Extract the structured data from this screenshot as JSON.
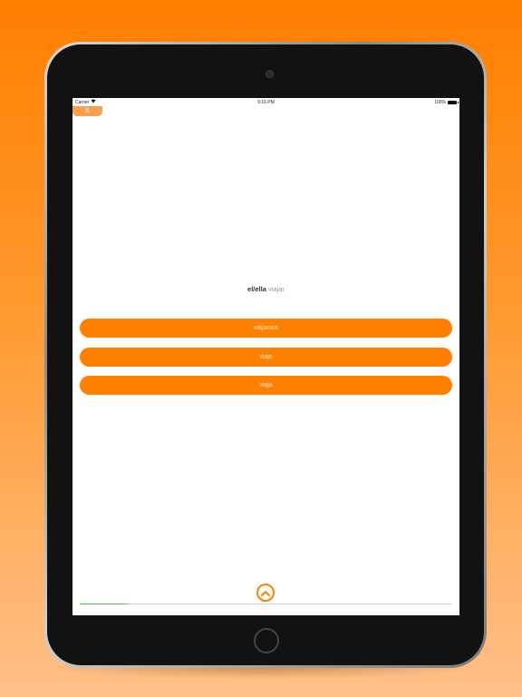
{
  "status_bar": {
    "carrier": "Carrier",
    "time": "9:16 PM",
    "battery": "100%"
  },
  "close_button": {
    "label": "X"
  },
  "prompt": {
    "subject": "el/ella",
    "verb": "viajar"
  },
  "answers": [
    {
      "label": "viajamos"
    },
    {
      "label": "viajo"
    },
    {
      "label": "viaja"
    }
  ],
  "progress": {
    "fraction": 0.13
  },
  "colors": {
    "accent": "#ff7f00",
    "progress": "#49c84a",
    "background_top": "#ff7f00",
    "background_bottom": "#ffc08a"
  },
  "icons": {
    "expand": "chevron-up-icon",
    "wifi": "wifi-icon",
    "battery": "battery-icon"
  }
}
